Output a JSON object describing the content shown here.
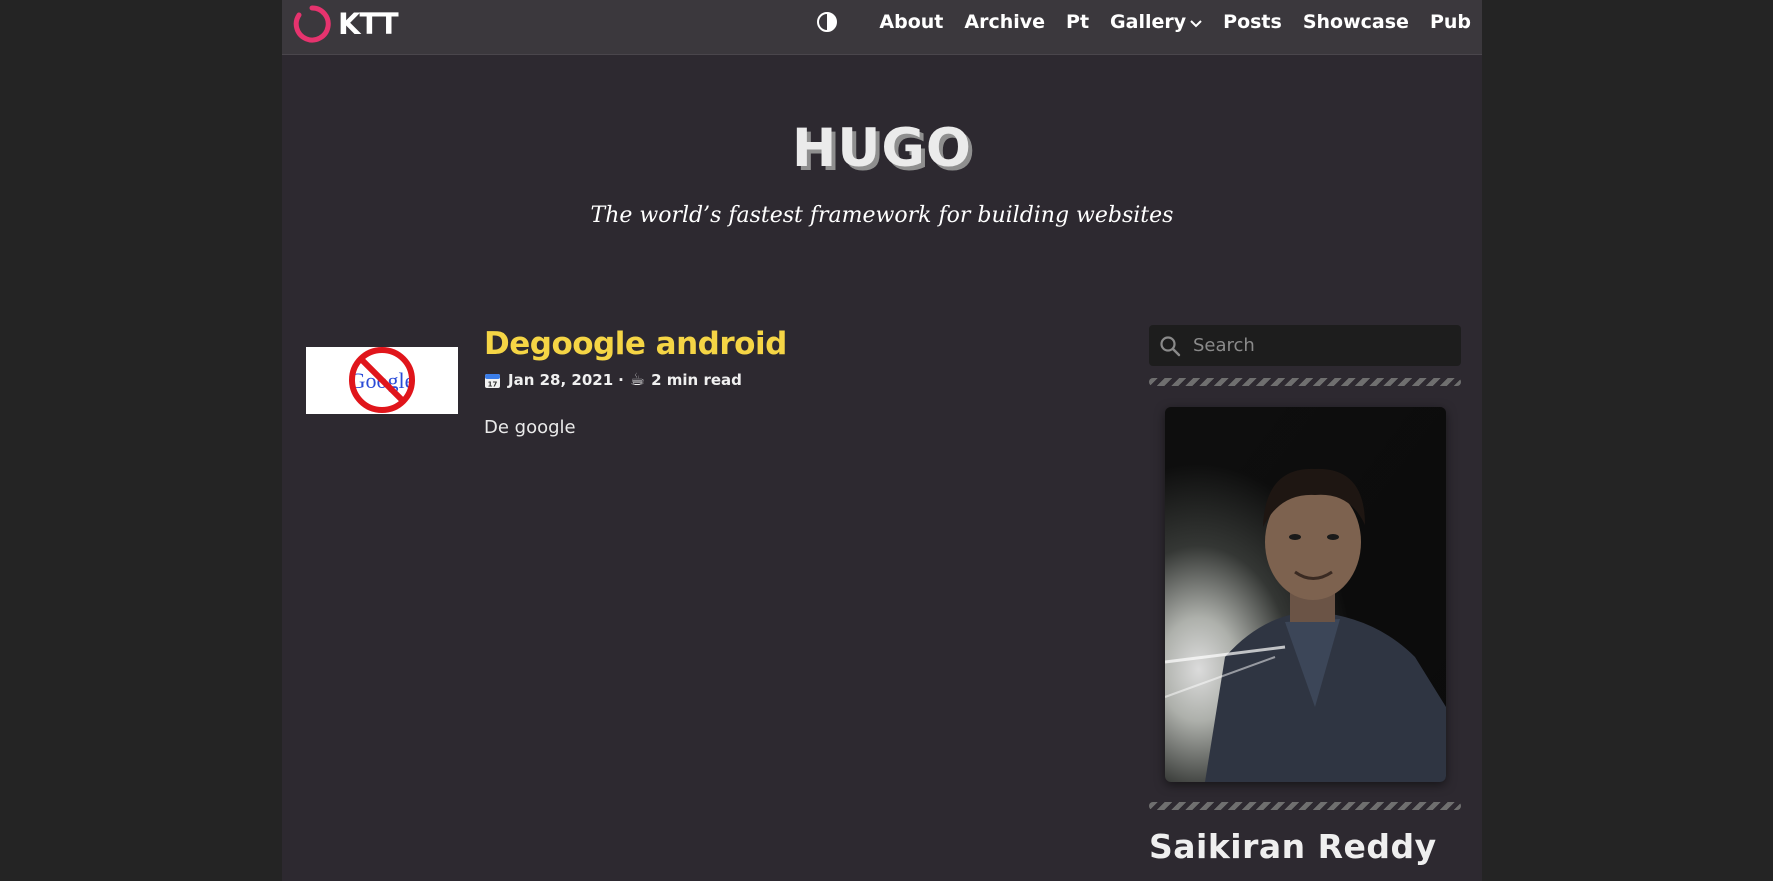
{
  "brand": {
    "name": "KTT",
    "accent": "#e6336e"
  },
  "nav": {
    "theme_toggle_icon": "contrast-half-circle-icon",
    "items": [
      "About",
      "Archive",
      "Pt",
      "Gallery",
      "Posts",
      "Showcase",
      "Pub"
    ],
    "dropdown_icon": "chevron-down-icon"
  },
  "hero": {
    "title": "HUGO",
    "subtitle": "The world’s fastest framework for building websites"
  },
  "post": {
    "title": "Degoogle android",
    "date": "Jan 28, 2021",
    "separator": "·",
    "read_time": "2 min read",
    "excerpt": "De google",
    "thumb_text": "Google",
    "title_color": "#f5d545"
  },
  "sidebar": {
    "search_placeholder": "Search",
    "author_name": "Saikiran Reddy"
  }
}
